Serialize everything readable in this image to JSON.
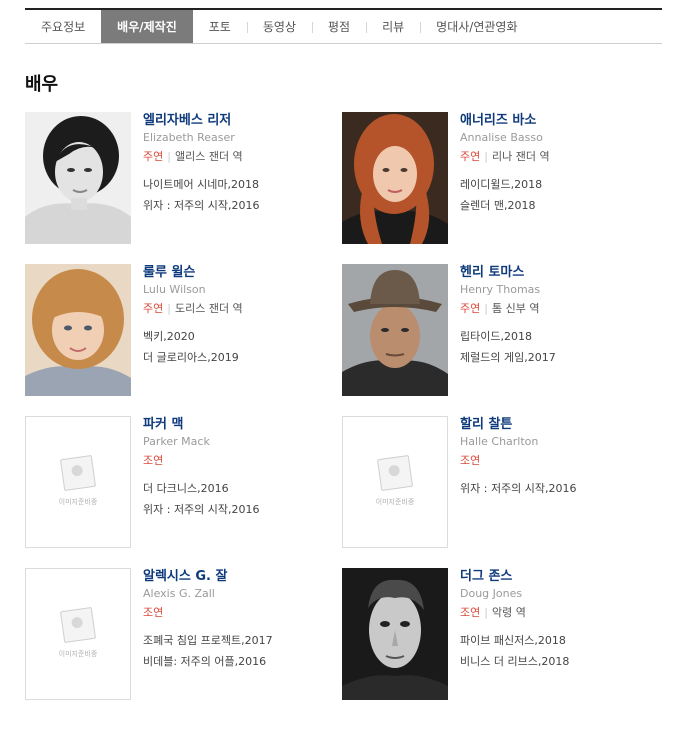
{
  "tabs": [
    {
      "label": "주요정보"
    },
    {
      "label": "배우/제작진"
    },
    {
      "label": "포토"
    },
    {
      "label": "동영상"
    },
    {
      "label": "평점"
    },
    {
      "label": "리뷰"
    },
    {
      "label": "명대사/연관영화"
    }
  ],
  "active_tab": "배우/제작진",
  "section_title": "배우",
  "placeholder_text": "이미지준비중",
  "actors": [
    {
      "name_ko": "엘리자베스 리저",
      "name_en": "Elizabeth Reaser",
      "role_type": "주연",
      "role_name": "앨리스 잰더 역",
      "works": [
        "나이트메어 시네마,2018",
        "위자 : 저주의 시작,2016"
      ]
    },
    {
      "name_ko": "애너리즈 바소",
      "name_en": "Annalise Basso",
      "role_type": "주연",
      "role_name": "리나 잰더 역",
      "works": [
        "레이디윌드,2018",
        "슬렌더 맨,2018"
      ]
    },
    {
      "name_ko": "룰루 윌슨",
      "name_en": "Lulu Wilson",
      "role_type": "주연",
      "role_name": "도리스 잰더 역",
      "works": [
        "벡키,2020",
        "더 글로리아스,2019"
      ]
    },
    {
      "name_ko": "헨리 토마스",
      "name_en": "Henry Thomas",
      "role_type": "주연",
      "role_name": "톰 신부 역",
      "works": [
        "립타이드,2018",
        "제럴드의 게임,2017"
      ]
    },
    {
      "name_ko": "파커 맥",
      "name_en": "Parker Mack",
      "role_type": "조연",
      "role_name": "",
      "works": [
        "더 다크니스,2016",
        "위자 : 저주의 시작,2016"
      ]
    },
    {
      "name_ko": "할리 찰튼",
      "name_en": "Halle Charlton",
      "role_type": "조연",
      "role_name": "",
      "works": [
        "위자 : 저주의 시작,2016"
      ]
    },
    {
      "name_ko": "알렉시스 G. 잘",
      "name_en": "Alexis G. Zall",
      "role_type": "조연",
      "role_name": "",
      "works": [
        "조폐국 침입 프로젝트,2017",
        "비데블: 저주의 어플,2016"
      ]
    },
    {
      "name_ko": "더그 존스",
      "name_en": "Doug Jones",
      "role_type": "조연",
      "role_name": "악령 역",
      "works": [
        "파이브 패신저스,2018",
        "비니스 더 리브스,2018"
      ]
    }
  ]
}
